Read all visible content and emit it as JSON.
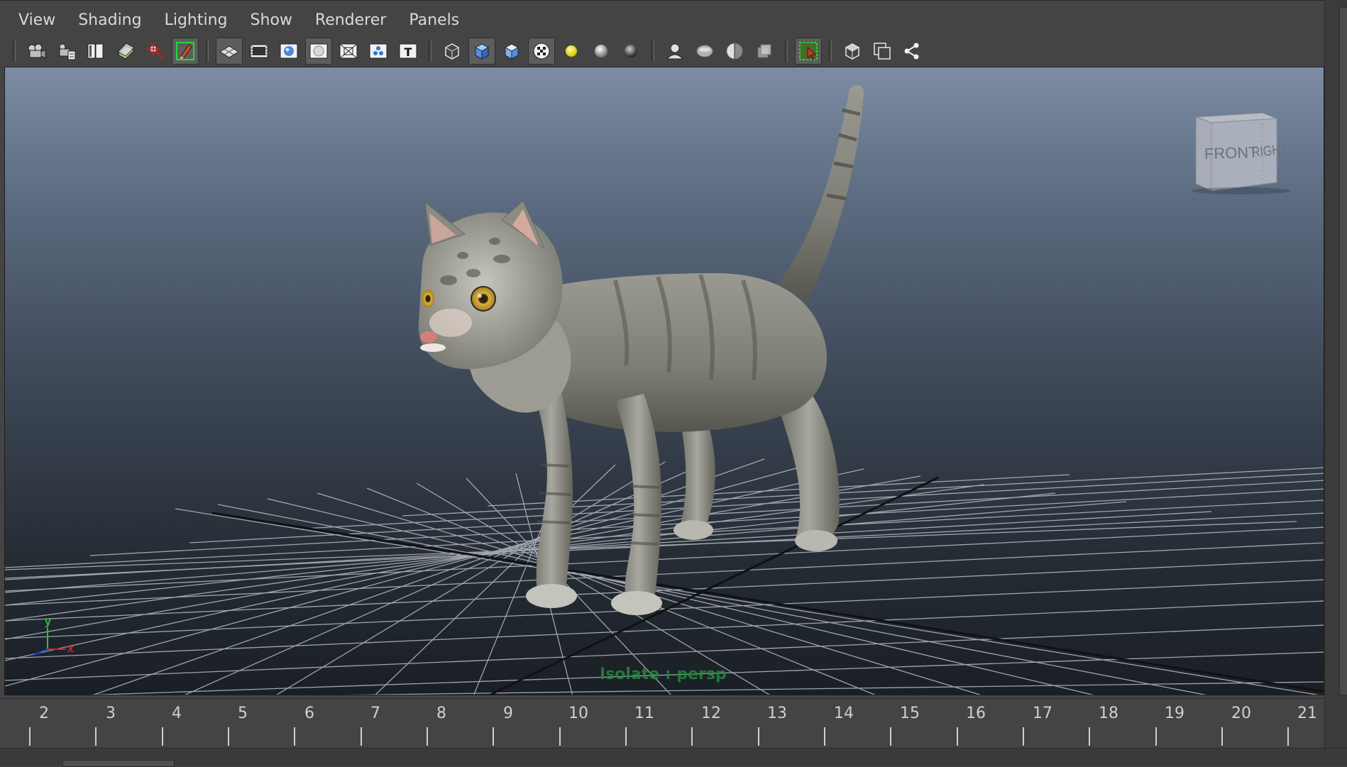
{
  "menubar": {
    "items": [
      "View",
      "Shading",
      "Lighting",
      "Show",
      "Renderer",
      "Panels"
    ]
  },
  "toolbar": {
    "groups": [
      [
        "select-camera-icon",
        "camera-attributes-icon",
        "bookmarks-icon",
        "image-plane-icon",
        "2d-pan-zoom-icon",
        "grease-pencil-icon"
      ],
      [
        "grid-icon",
        "film-gate-icon",
        "resolution-gate-icon",
        "gate-mask-icon",
        "field-chart-icon",
        "safe-action-icon",
        "safe-title-icon"
      ],
      [
        "wireframe-icon",
        "smooth-shade-all-icon",
        "use-default-material-icon",
        "textured-icon",
        "use-all-lights-icon",
        "shadows-icon",
        "ambient-occlusion-icon"
      ],
      [
        "isolate-select-icon",
        "xray-icon",
        "xray-active-components-icon",
        "xray-joints-icon"
      ],
      [
        "select-objects-icon"
      ],
      [
        "show-all-icon",
        "frame-selection-icon",
        "node-editor-icon"
      ]
    ]
  },
  "viewport": {
    "camera_label": "Isolate : persp",
    "viewcube": {
      "front": "FRONT",
      "right": "RIGHT"
    },
    "axis": {
      "x": "x",
      "y": "y"
    }
  },
  "timeline": {
    "ticks": [
      "2",
      "3",
      "4",
      "5",
      "6",
      "7",
      "8",
      "9",
      "10",
      "11",
      "12",
      "13",
      "14",
      "15",
      "16",
      "17",
      "18",
      "19",
      "20",
      "21"
    ]
  },
  "colors": {
    "ui_bg": "#444444",
    "menu_text": "#d9d9d9",
    "viewport_top": "#7b8ca3",
    "viewport_bottom": "#1a1f25",
    "camera_label": "#1f8a3a",
    "axis_x": "#d62020",
    "axis_y": "#28c43a",
    "axis_z": "#2040e0"
  }
}
